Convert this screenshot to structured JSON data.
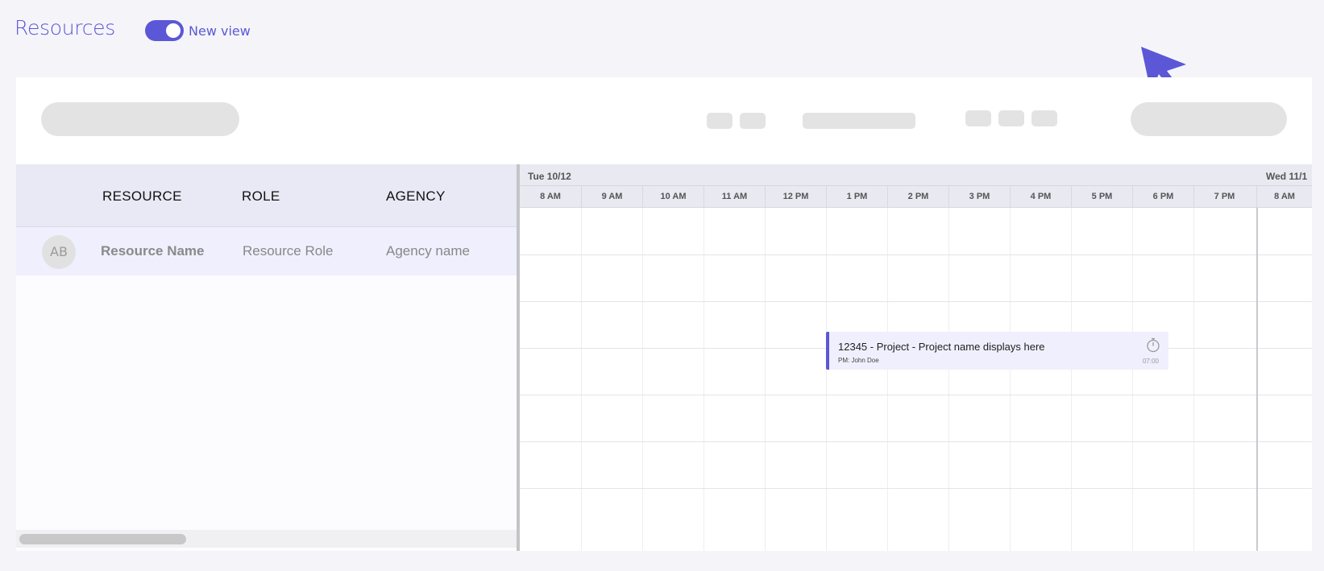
{
  "header": {
    "title": "Resources",
    "toggle_label": "New view",
    "toggle_on": true
  },
  "table": {
    "columns": [
      "RESOURCE",
      "ROLE",
      "AGENCY"
    ],
    "rows": [
      {
        "initials": "AB",
        "name": "Resource Name",
        "role": "Resource Role",
        "agency": "Agency name"
      }
    ]
  },
  "calendar": {
    "days": [
      "Tue 10/12",
      "Wed 11/1"
    ],
    "hours": [
      "8 AM",
      "9 AM",
      "10 AM",
      "11 AM",
      "12 PM",
      "1 PM",
      "2 PM",
      "3 PM",
      "4 PM",
      "5 PM",
      "6 PM",
      "7 PM",
      "8 AM"
    ],
    "event": {
      "title": "12345 - Project - Project name displays here",
      "pm": "PM: John Doe",
      "duration": "07:00",
      "icon": "stopwatch-icon"
    }
  },
  "colors": {
    "accent": "#5b57d6",
    "event_bg": "#f0effd",
    "header_bg": "#e8e9f4",
    "placeholder": "#e3e3e3"
  },
  "icons": [
    "cursor-arrow-icon",
    "stopwatch-icon"
  ]
}
